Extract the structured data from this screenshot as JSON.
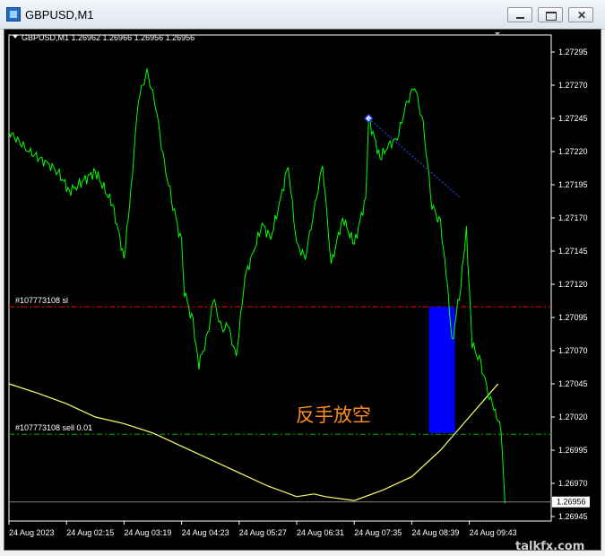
{
  "window": {
    "title": "GBPUSD,M1",
    "buttons": {
      "minimize": "minimize-icon",
      "restore": "restore-icon",
      "close": "close-icon"
    }
  },
  "chart": {
    "header": "GBPUSD,M1  1.26962 1.26966 1.26956 1.26956",
    "current_price_label": "1.26956",
    "sl_label": "#107773108 sl",
    "sell_label": "#107773108 sell 0.01",
    "annotation": "反手放空",
    "watermark": "talkfx.com",
    "colors": {
      "background": "#000000",
      "price": "#00ff00",
      "ma": "#ffff66",
      "sl_line": "#ff0000",
      "entry_line": "#00aa00",
      "box": "#0000ff",
      "annotation": "#ff8c1a",
      "text": "#ffffff"
    }
  },
  "chart_data": {
    "type": "line",
    "symbol": "GBPUSD",
    "timeframe": "M1",
    "ylim": [
      1.26945,
      1.27295
    ],
    "y_ticks": [
      1.27295,
      1.2727,
      1.27245,
      1.2722,
      1.27195,
      1.2717,
      1.27145,
      1.2712,
      1.27095,
      1.2707,
      1.27045,
      1.2702,
      1.26995,
      1.2697,
      1.26945
    ],
    "x_ticks": [
      "24 Aug 2023",
      "24 Aug 02:15",
      "24 Aug 03:19",
      "24 Aug 04:23",
      "24 Aug 05:27",
      "24 Aug 06:31",
      "24 Aug 07:35",
      "24 Aug 08:39",
      "24 Aug 09:43"
    ],
    "price_series": {
      "x": [
        0,
        0.35,
        0.7,
        0.85,
        1.05,
        1.2,
        1.5,
        1.8,
        2.0,
        2.1,
        2.25,
        2.4,
        2.55,
        2.7,
        2.85,
        3.0,
        3.05,
        3.2,
        3.3,
        3.45,
        3.55,
        3.7,
        3.8,
        3.95,
        4.1,
        4.25,
        4.4,
        4.55,
        4.7,
        4.85,
        5.0,
        5.15,
        5.3,
        5.45,
        5.6,
        5.8,
        6.0,
        6.2,
        6.25,
        6.45,
        6.6,
        6.75,
        6.9,
        7.05,
        7.2,
        7.35,
        7.5,
        7.6,
        7.7,
        7.85,
        7.95,
        8.05,
        8.2,
        8.35,
        8.45,
        8.55,
        8.62
      ],
      "y": [
        1.27235,
        1.2722,
        1.2721,
        1.27205,
        1.2719,
        1.27195,
        1.27205,
        1.2718,
        1.2714,
        1.2718,
        1.2726,
        1.2728,
        1.27255,
        1.2721,
        1.2718,
        1.2715,
        1.27115,
        1.2709,
        1.2706,
        1.2708,
        1.2711,
        1.27085,
        1.2709,
        1.27065,
        1.27125,
        1.27145,
        1.27165,
        1.27155,
        1.2718,
        1.2721,
        1.2715,
        1.2714,
        1.27175,
        1.2721,
        1.27135,
        1.2717,
        1.2715,
        1.27185,
        1.27245,
        1.27215,
        1.27225,
        1.2723,
        1.27255,
        1.2727,
        1.2724,
        1.2718,
        1.27165,
        1.2713,
        1.27075,
        1.2712,
        1.2716,
        1.27075,
        1.2706,
        1.27035,
        1.27025,
        1.2701,
        1.26955
      ]
    },
    "ma_series": {
      "x": [
        0,
        0.5,
        1.0,
        1.5,
        2.0,
        2.5,
        3.0,
        3.5,
        4.0,
        4.5,
        5.0,
        5.3,
        5.5,
        6.0,
        6.5,
        7.0,
        7.5,
        8.0,
        8.3,
        8.5
      ],
      "y": [
        1.27045,
        1.27038,
        1.2703,
        1.2702,
        1.27015,
        1.27008,
        1.26998,
        1.26988,
        1.26978,
        1.26968,
        1.2696,
        1.26962,
        1.2696,
        1.26957,
        1.26965,
        1.26975,
        1.26995,
        1.2702,
        1.27035,
        1.27045
      ]
    },
    "sl_level": 1.27103,
    "entry_level": 1.27007,
    "entry_marker": {
      "x": 6.25,
      "y": 1.27245
    },
    "box": {
      "x_start": 7.3,
      "x_end": 7.75,
      "top": 1.27103,
      "bottom": 1.27008
    }
  }
}
